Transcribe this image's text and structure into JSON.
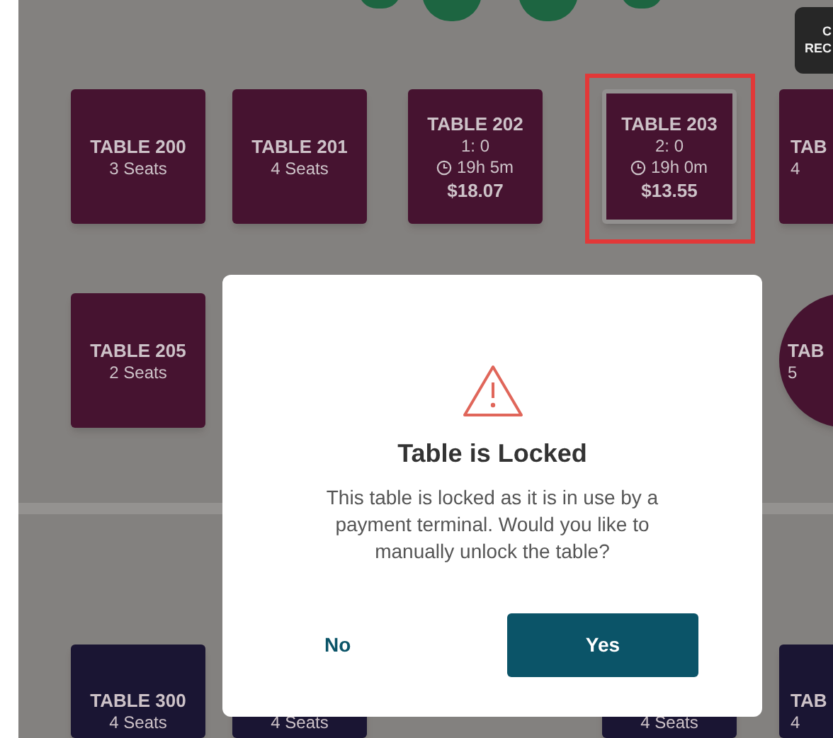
{
  "floor_plan": {
    "corner_button": {
      "lines": [
        "C",
        "REC"
      ]
    },
    "tables": [
      {
        "kind": "square",
        "color": "#4a1533",
        "label": "TABLE 200",
        "seats": "3 Seats",
        "highlighted": false
      },
      {
        "kind": "square",
        "color": "#4a1533",
        "label": "TABLE 201",
        "seats": "4 Seats",
        "highlighted": false
      },
      {
        "kind": "square",
        "color": "#4a1533",
        "label": "TABLE 202",
        "guests": "1: 0",
        "time": "19h 5m",
        "total": "$18.07",
        "highlighted": false
      },
      {
        "kind": "square",
        "color": "#4a1533",
        "label": "TABLE 203",
        "guests": "2: 0",
        "time": "19h 0m",
        "total": "$13.55",
        "highlighted": true
      },
      {
        "kind": "square",
        "color": "#4a1533",
        "label": "TAB",
        "seats": "4",
        "highlighted": false
      },
      {
        "kind": "square",
        "color": "#4a1533",
        "label": "TABLE 205",
        "seats": "2 Seats",
        "highlighted": false
      },
      {
        "kind": "round",
        "color": "#4a1533",
        "label": "TAB",
        "seats": "5",
        "highlighted": false
      },
      {
        "kind": "square",
        "color": "#1c1736",
        "label": "TABLE 300",
        "seats": "4 Seats",
        "highlighted": false
      },
      {
        "kind": "square",
        "color": "#1c1736",
        "seats": "4 Seats",
        "highlighted": false
      },
      {
        "kind": "square",
        "color": "#1c1736",
        "seats": "4 Seats",
        "highlighted": false
      },
      {
        "kind": "square",
        "color": "#1c1736",
        "label": "TAB",
        "seats": "4",
        "highlighted": false
      }
    ]
  },
  "dialog": {
    "title": "Table is Locked",
    "message": "This table is locked as it is in use by a payment terminal. Would you like to manually unlock the table?",
    "buttons": [
      {
        "label": "No",
        "kind": "secondary"
      },
      {
        "label": "Yes",
        "kind": "primary"
      }
    ]
  }
}
